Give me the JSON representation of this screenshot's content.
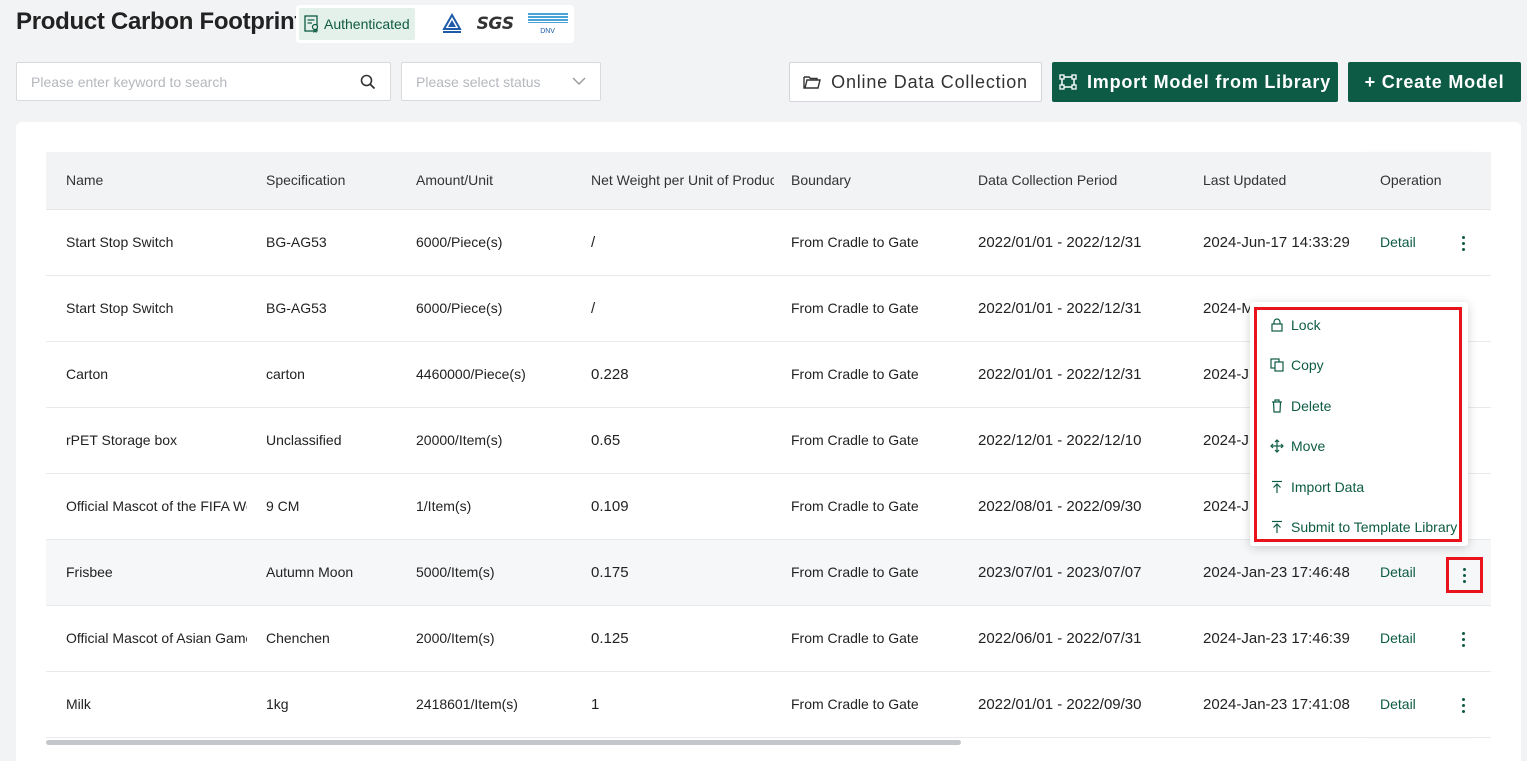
{
  "header": {
    "title": "Product Carbon Footprint",
    "badge": "Authenticated",
    "logos": {
      "sgs": "SGS",
      "dnv": "DNV"
    }
  },
  "toolbar": {
    "search_placeholder": "Please enter keyword to search",
    "status_placeholder": "Please select status",
    "online_label": "Online Data Collection",
    "import_label": "Import Model from Library",
    "create_label": "+ Create Model"
  },
  "table": {
    "columns": [
      "Name",
      "Specification",
      "Amount/Unit",
      "Net Weight per Unit of Product(",
      "Boundary",
      "Data Collection Period",
      "Last Updated",
      "Operation"
    ],
    "detail_label": "Detail",
    "rows": [
      {
        "name": "Start Stop Switch",
        "spec": "BG-AG53",
        "amount": "6000/Piece(s)",
        "net": "/",
        "boundary": "From Cradle to Gate",
        "period": "2022/01/01 - 2022/12/31",
        "updated": "2024-Jun-17 14:33:29"
      },
      {
        "name": "Start Stop Switch",
        "spec": "BG-AG53",
        "amount": "6000/Piece(s)",
        "net": "/",
        "boundary": "From Cradle to Gate",
        "period": "2022/01/01 - 2022/12/31",
        "updated": "2024-M"
      },
      {
        "name": "Carton",
        "spec": "carton",
        "amount": "4460000/Piece(s)",
        "net": "0.228",
        "boundary": "From Cradle to Gate",
        "period": "2022/01/01 - 2022/12/31",
        "updated": "2024-J"
      },
      {
        "name": "rPET Storage box",
        "spec": "Unclassified",
        "amount": "20000/Item(s)",
        "net": "0.65",
        "boundary": "From Cradle to Gate",
        "period": "2022/12/01 - 2022/12/10",
        "updated": "2024-J"
      },
      {
        "name": "Official Mascot of the FIFA Wor",
        "spec": "9 CM",
        "amount": "1/Item(s)",
        "net": "0.109",
        "boundary": "From Cradle to Gate",
        "period": "2022/08/01 - 2022/09/30",
        "updated": "2024-J"
      },
      {
        "name": "Frisbee",
        "spec": "Autumn Moon",
        "amount": "5000/Item(s)",
        "net": "0.175",
        "boundary": "From Cradle to Gate",
        "period": "2023/07/01 - 2023/07/07",
        "updated": "2024-Jan-23 17:46:48"
      },
      {
        "name": "Official Mascot of Asian Games",
        "spec": "Chenchen",
        "amount": "2000/Item(s)",
        "net": "0.125",
        "boundary": "From Cradle to Gate",
        "period": "2022/06/01 - 2022/07/31",
        "updated": "2024-Jan-23 17:46:39"
      },
      {
        "name": "Milk",
        "spec": "1kg",
        "amount": "2418601/Item(s)",
        "net": "1",
        "boundary": "From Cradle to Gate",
        "period": "2022/01/01 - 2022/09/30",
        "updated": "2024-Jan-23 17:41:08"
      }
    ]
  },
  "menu": {
    "items": [
      "Lock",
      "Copy",
      "Delete",
      "Move",
      "Import Data",
      "Submit to Template Library"
    ]
  },
  "colors": {
    "brand": "#0d5b44",
    "highlight": "#e8131b",
    "background": "#f2f3f5"
  }
}
